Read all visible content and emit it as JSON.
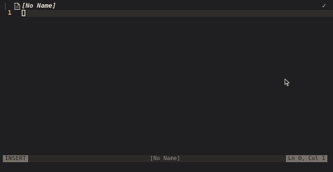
{
  "tab": {
    "title": "[No Name]",
    "status_icon": "check-icon",
    "status_glyph": "✓",
    "file_icon": "document-icon"
  },
  "editor": {
    "line_numbers": [
      "1"
    ],
    "current_line_text": ""
  },
  "statusbar": {
    "mode": "INSERT",
    "filename": "[No Name]",
    "position": "Ln 0, Col 1"
  },
  "colors": {
    "background": "#1f1f21",
    "line_highlight": "#2e2d2b",
    "line_number": "#e2b66a",
    "badge_bg": "#77706a"
  }
}
